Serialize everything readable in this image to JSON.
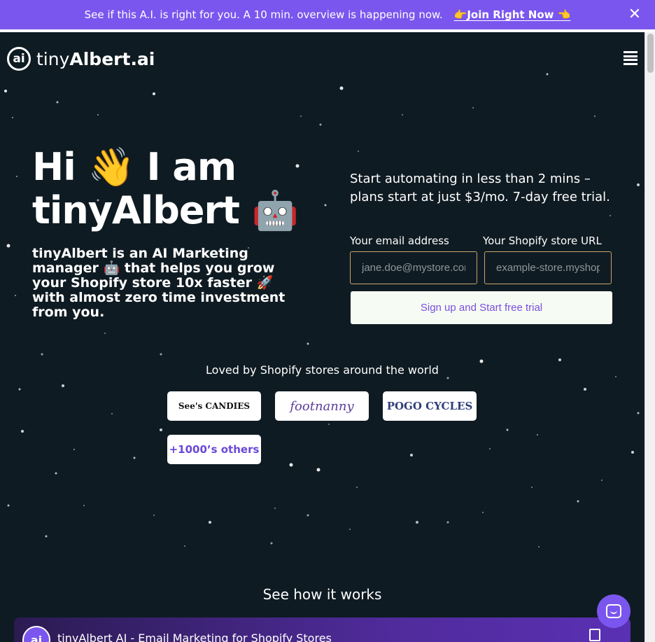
{
  "banner": {
    "text": "See if this A.I. is right for you. A 10 min. overview is happening now.",
    "cta": "👉Join Right Now 👈",
    "close": "✕"
  },
  "nav": {
    "logo_mark": "ai",
    "logo_text_light": "tiny",
    "logo_text_bold": "Albert.ai",
    "menu_icon": "hamburger-menu-icon"
  },
  "hero": {
    "title_line1": "Hi 👋 I am",
    "title_line2": "tinyAlbert",
    "title_emoji": "🤖",
    "subtitle_part1": "tinyAlbert is an AI Marketing manager",
    "subtitle_emoji1": "🤖",
    "subtitle_part2": "that helps you grow your Shopify store 10x faster",
    "subtitle_emoji2": "🚀",
    "subtitle_part3": "with almost zero time investment from you."
  },
  "signup": {
    "pitch": "Start automating in less than 2 mins – plans start at just $3/mo. 7-day free trial.",
    "email_label": "Your email address",
    "email_placeholder": "jane.doe@mystore.com",
    "store_label": "Your Shopify store URL",
    "store_placeholder": "example-store.myshopify.com",
    "button": "Sign up and Start free trial"
  },
  "social_proof": {
    "heading": "Loved by Shopify stores around the world",
    "brands": [
      "See's CANDIES",
      "footnanny",
      "POGO CYCLES"
    ],
    "others": "+1000’s others"
  },
  "how": {
    "heading": "See how it works",
    "video_title": "tinyAlbert AI - Email Marketing for Shopify Stores",
    "video_logo": "ai"
  },
  "colors": {
    "background": "#0f1b22",
    "accent": "#7a56ee",
    "button_bg": "#f6fbf3"
  }
}
